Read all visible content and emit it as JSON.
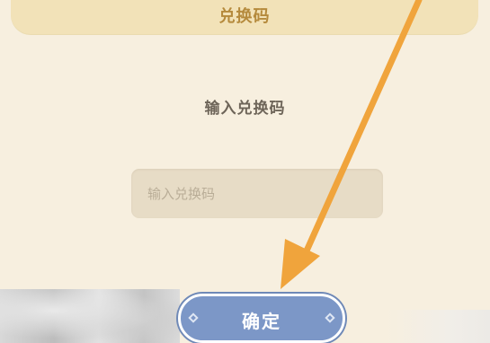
{
  "dialog": {
    "title": "兑换码",
    "prompt": "输入兑换码",
    "input_placeholder": "输入兑换码",
    "input_value": "",
    "confirm_label": "确定"
  },
  "colors": {
    "background": "#f7efdf",
    "title_bar": "#f2e2b8",
    "title_text": "#b58a3c",
    "input_bg": "#e7dcc6",
    "button": "#7c97c7",
    "arrow": "#f0a43c"
  },
  "icons": {
    "annotation": "orange-arrow-icon",
    "button_left_deco": "diamond-icon",
    "button_right_deco": "diamond-icon"
  }
}
